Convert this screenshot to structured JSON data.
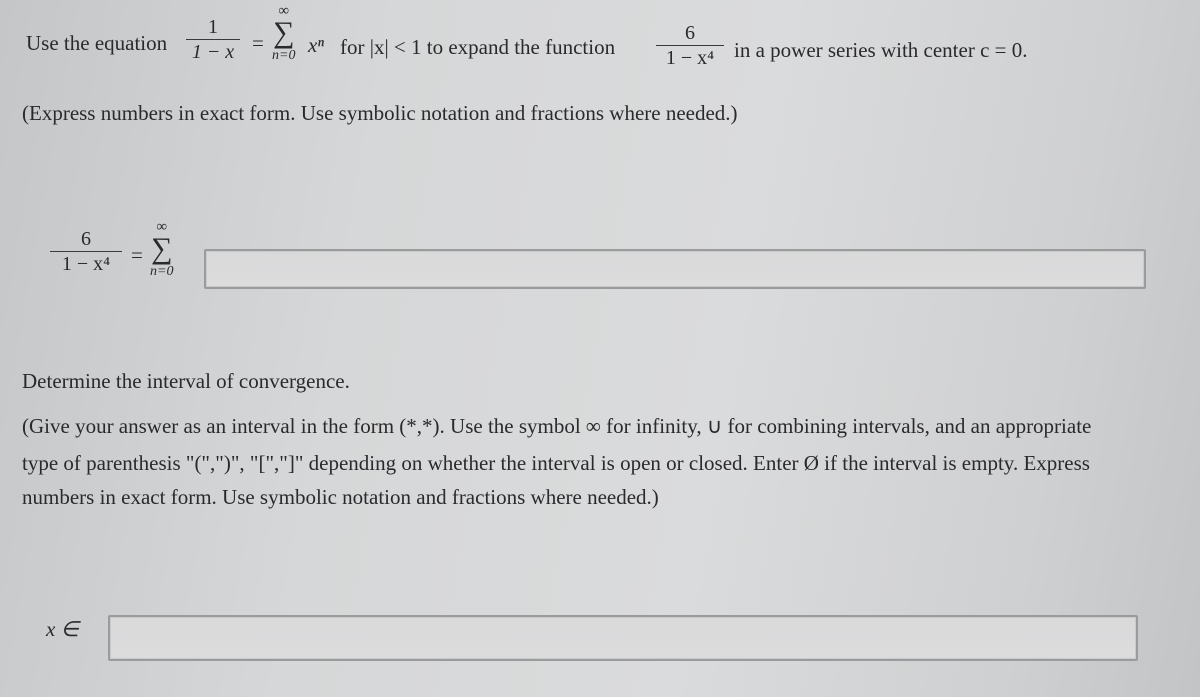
{
  "question": {
    "line1": {
      "intro": "Use the equation",
      "eq_fraction": {
        "numerator": "1",
        "denominator": "1 − x"
      },
      "equals": "=",
      "sum": {
        "upper": "∞",
        "symbol": "∑",
        "lower": "n=0"
      },
      "term": "xⁿ",
      "condition": "for |x| < 1 to expand the function",
      "func_fraction": {
        "numerator": "6",
        "denominator": "1 − x⁴"
      },
      "suffix": "in a power series with center c = 0."
    },
    "instruction": "(Express numbers in exact form. Use symbolic notation and fractions where needed.)"
  },
  "series_answer": {
    "fraction": {
      "numerator": "6",
      "denominator": "1 − x⁴"
    },
    "equals": "=",
    "sum": {
      "upper": "∞",
      "symbol": "∑",
      "lower": "n=0"
    },
    "input_value": ""
  },
  "interval_question": {
    "title": "Determine the interval of convergence.",
    "instructions_line1": "(Give your answer as an interval in the form (*,*). Use the symbol ∞ for infinity, ∪ for combining intervals, and an appropriate",
    "instructions_line2": "type of parenthesis \"(\",\")\", \"[\",\"]\" depending on whether the interval is open or closed. Enter Ø if the interval is empty. Express",
    "instructions_line3": "numbers in exact form. Use symbolic notation and fractions where needed.)"
  },
  "interval_answer": {
    "label": "x ∈",
    "input_value": ""
  }
}
